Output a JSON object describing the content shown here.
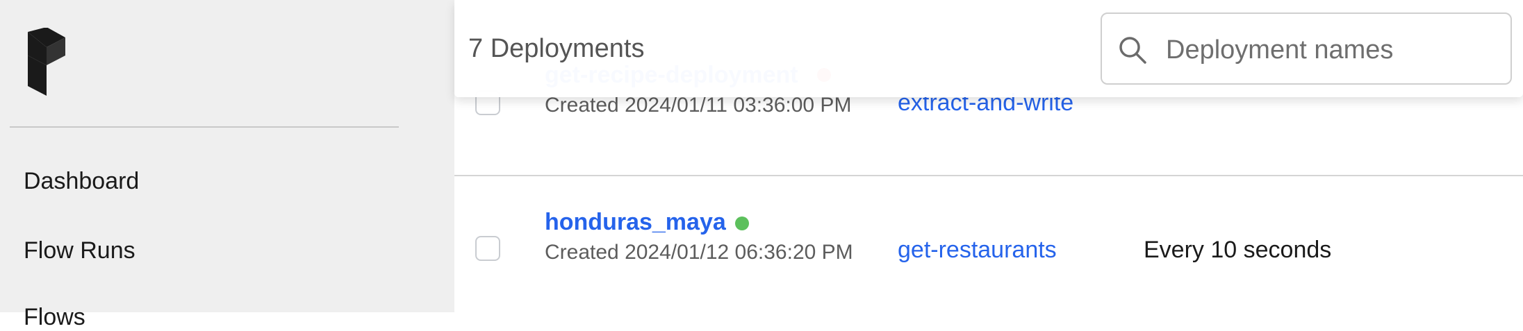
{
  "sidebar": {
    "items": [
      {
        "label": "Dashboard"
      },
      {
        "label": "Flow Runs"
      },
      {
        "label": "Flows"
      }
    ]
  },
  "header": {
    "count_label": "7 Deployments",
    "search_placeholder": "Deployment names"
  },
  "rows": [
    {
      "name": "get-recipe-deployment",
      "status_color": "#ef4444",
      "created": "Created 2024/01/11 03:36:00 PM",
      "flow": "extract-and-write",
      "schedule": ""
    },
    {
      "name": "honduras_maya",
      "status_color": "#5cc05c",
      "created": "Created 2024/01/12 06:36:20 PM",
      "flow": "get-restaurants",
      "schedule": "Every 10 seconds"
    }
  ],
  "colors": {
    "link": "#2563eb",
    "sidebar_bg": "#efefef"
  }
}
